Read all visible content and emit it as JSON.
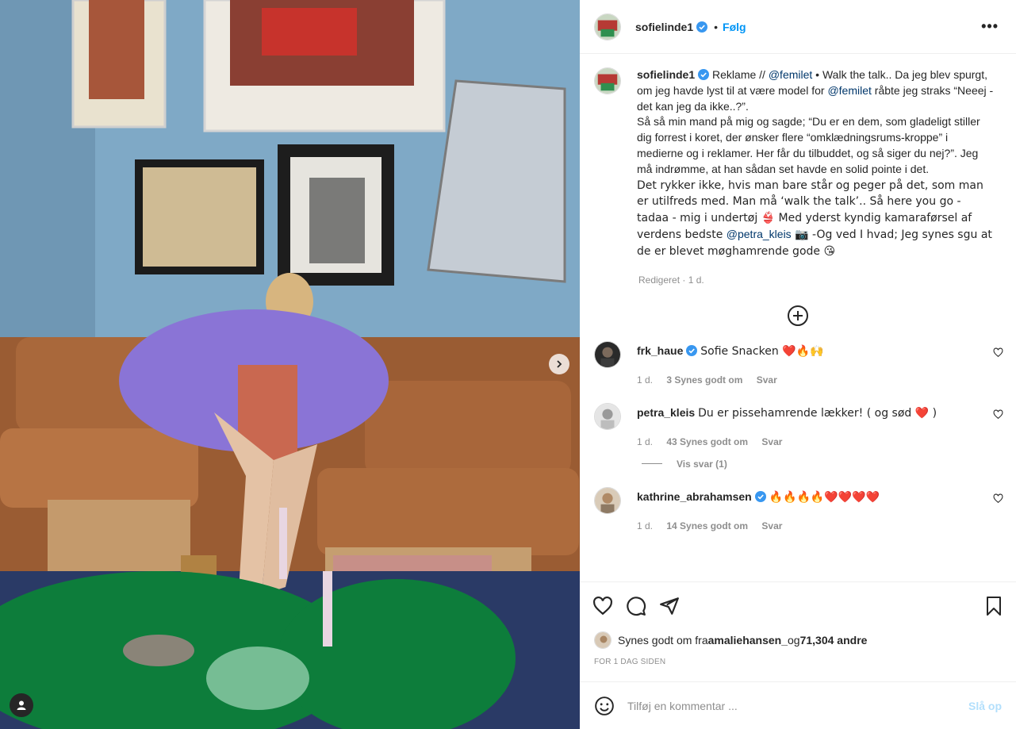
{
  "post": {
    "author": "sofielinde1",
    "follow_label": "Følg",
    "dot": "•",
    "more_label": "•••"
  },
  "caption": {
    "author": "sofielinde1",
    "p1_a": " Reklame // ",
    "mention1": "@femilet",
    "p1_b": " • Walk the talk.. Da jeg blev spurgt, om jeg havde lyst til at være model for ",
    "mention2": "@femilet",
    "p1_c": " råbte jeg straks “Neeej - det kan jeg da ikke..?”.",
    "p2": "Så så min mand på mig og sagde; “Du er en dem, som gladeligt stiller dig forrest i koret, der ønsker flere “omklædningsrums-kroppe” i medierne og i reklamer. Her får du tilbuddet, og så siger du nej?”. Jeg må indrømme, at han sådan set havde en solid pointe i det.",
    "p3_a": "Det rykker ikke, hvis man bare står og peger på det, som man er utilfreds med. Man må ‘walk the talk’.. Så here you go - tadaa - mig i undertøj 👙 Med yderst kyndig kamaraførsel af verdens bedste ",
    "mention3": "@petra_kleis",
    "p3_b": " 📷 -Og ved I hvad; Jeg synes sgu at de er blevet møghamrende gode 😘",
    "meta": "Redigeret · 1 d."
  },
  "comments": [
    {
      "user": "frk_haue",
      "text": "Sofie Snacken ❤️🔥🙌",
      "time": "1 d.",
      "likes": "3 Synes godt om",
      "reply": "Svar"
    },
    {
      "user": "petra_kleis",
      "text": "Du er pissehamrende lækker! ( og sød ❤️ )",
      "time": "1 d.",
      "likes": "43 Synes godt om",
      "reply": "Svar",
      "view_replies": "Vis svar (1)"
    },
    {
      "user": "kathrine_abrahamsen",
      "text": "🔥🔥🔥🔥❤️❤️❤️❤️",
      "time": "1 d.",
      "likes": "14 Synes godt om",
      "reply": "Svar"
    }
  ],
  "likes": {
    "prefix": "Synes godt om fra ",
    "user": "amaliehansen_",
    "conj": " og ",
    "others": "71,304 andre"
  },
  "time_ago": "FOR 1 DAG SIDEN",
  "add_comment": {
    "placeholder": "Tilføj en kommentar ...",
    "post_label": "Slå op"
  },
  "colors": {
    "link": "#00376b",
    "follow": "#0095f6",
    "muted": "#8e8e8e",
    "verified": "#3897f0"
  },
  "icons": [
    "verified-badge-icon",
    "more-options-icon",
    "add-circle-icon",
    "heart-icon",
    "comment-icon",
    "share-icon",
    "bookmark-icon",
    "emoji-icon",
    "chevron-right-icon",
    "user-tag-icon"
  ]
}
